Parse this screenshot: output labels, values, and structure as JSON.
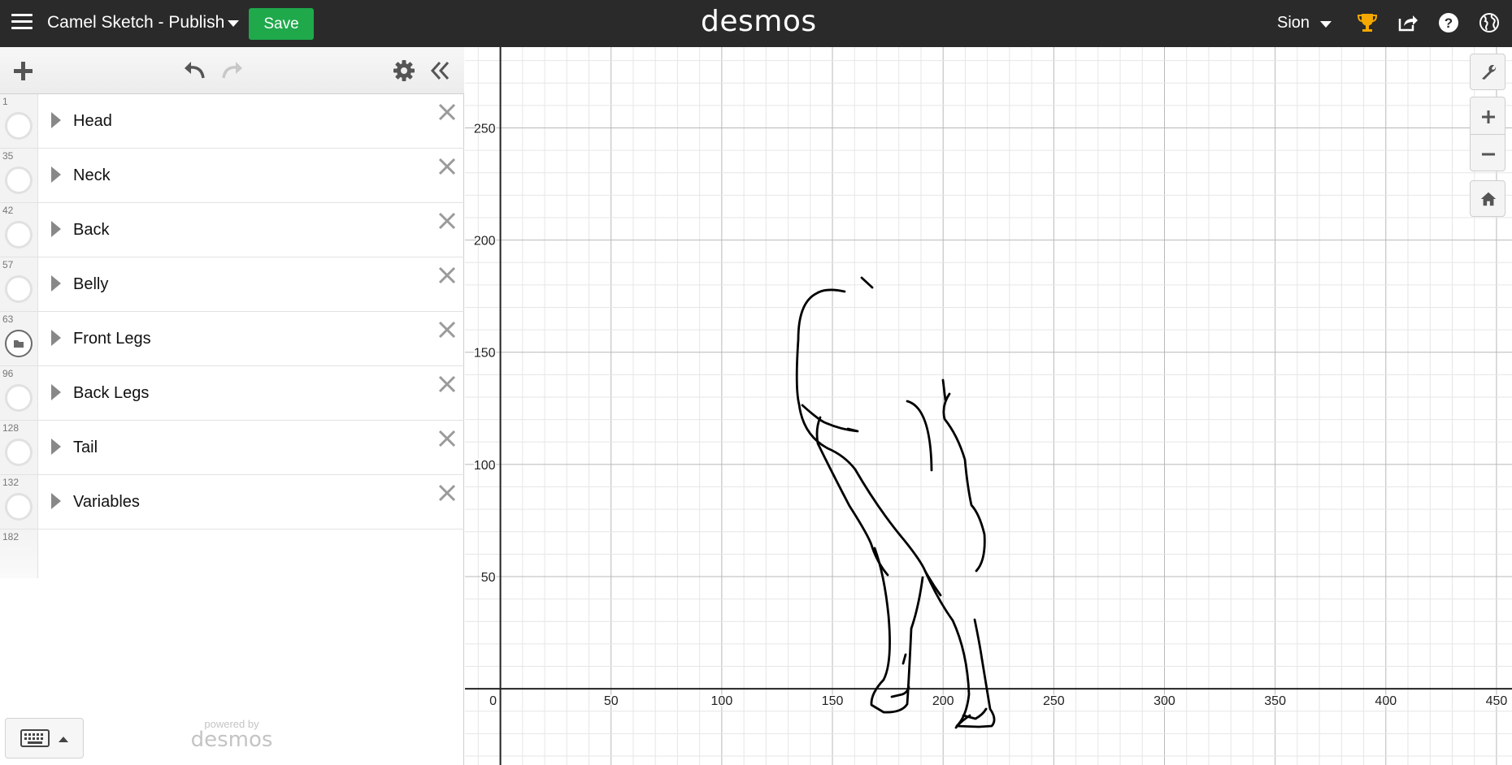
{
  "header": {
    "title": "Camel Sketch - Publish",
    "save_label": "Save",
    "logo": "desmos",
    "user_name": "Sion"
  },
  "expressions": [
    {
      "index": "1",
      "label": "Head",
      "icon": "circle"
    },
    {
      "index": "35",
      "label": "Neck",
      "icon": "circle"
    },
    {
      "index": "42",
      "label": "Back",
      "icon": "circle"
    },
    {
      "index": "57",
      "label": "Belly",
      "icon": "circle"
    },
    {
      "index": "63",
      "label": "Front Legs",
      "icon": "folder"
    },
    {
      "index": "96",
      "label": "Back Legs",
      "icon": "circle"
    },
    {
      "index": "128",
      "label": "Tail",
      "icon": "circle"
    },
    {
      "index": "132",
      "label": "Variables",
      "icon": "circle"
    }
  ],
  "next_index": "182",
  "footer": {
    "powered_by": "powered by",
    "logo": "desmos"
  },
  "graph": {
    "x_ticks": [
      0,
      50,
      100,
      150,
      200,
      250,
      300,
      350,
      400,
      450
    ],
    "y_ticks": [
      50,
      100,
      150,
      200,
      250
    ],
    "x_range": [
      -16,
      457
    ],
    "y_range": [
      -34,
      286
    ],
    "minor_step": 10,
    "major_step": 50,
    "curve_color": "#000000"
  },
  "icons": {
    "menu": "hamburger-icon",
    "add": "plus-icon",
    "undo": "undo-icon",
    "redo": "redo-icon",
    "settings": "gear-icon",
    "collapse": "double-chevron-left-icon",
    "achievements": "trophy-icon",
    "share": "share-icon",
    "help": "help-icon",
    "language": "globe-icon",
    "wrench": "wrench-icon",
    "zoom_in": "plus-icon",
    "zoom_out": "minus-icon",
    "home": "home-icon",
    "keyboard": "keyboard-icon"
  }
}
